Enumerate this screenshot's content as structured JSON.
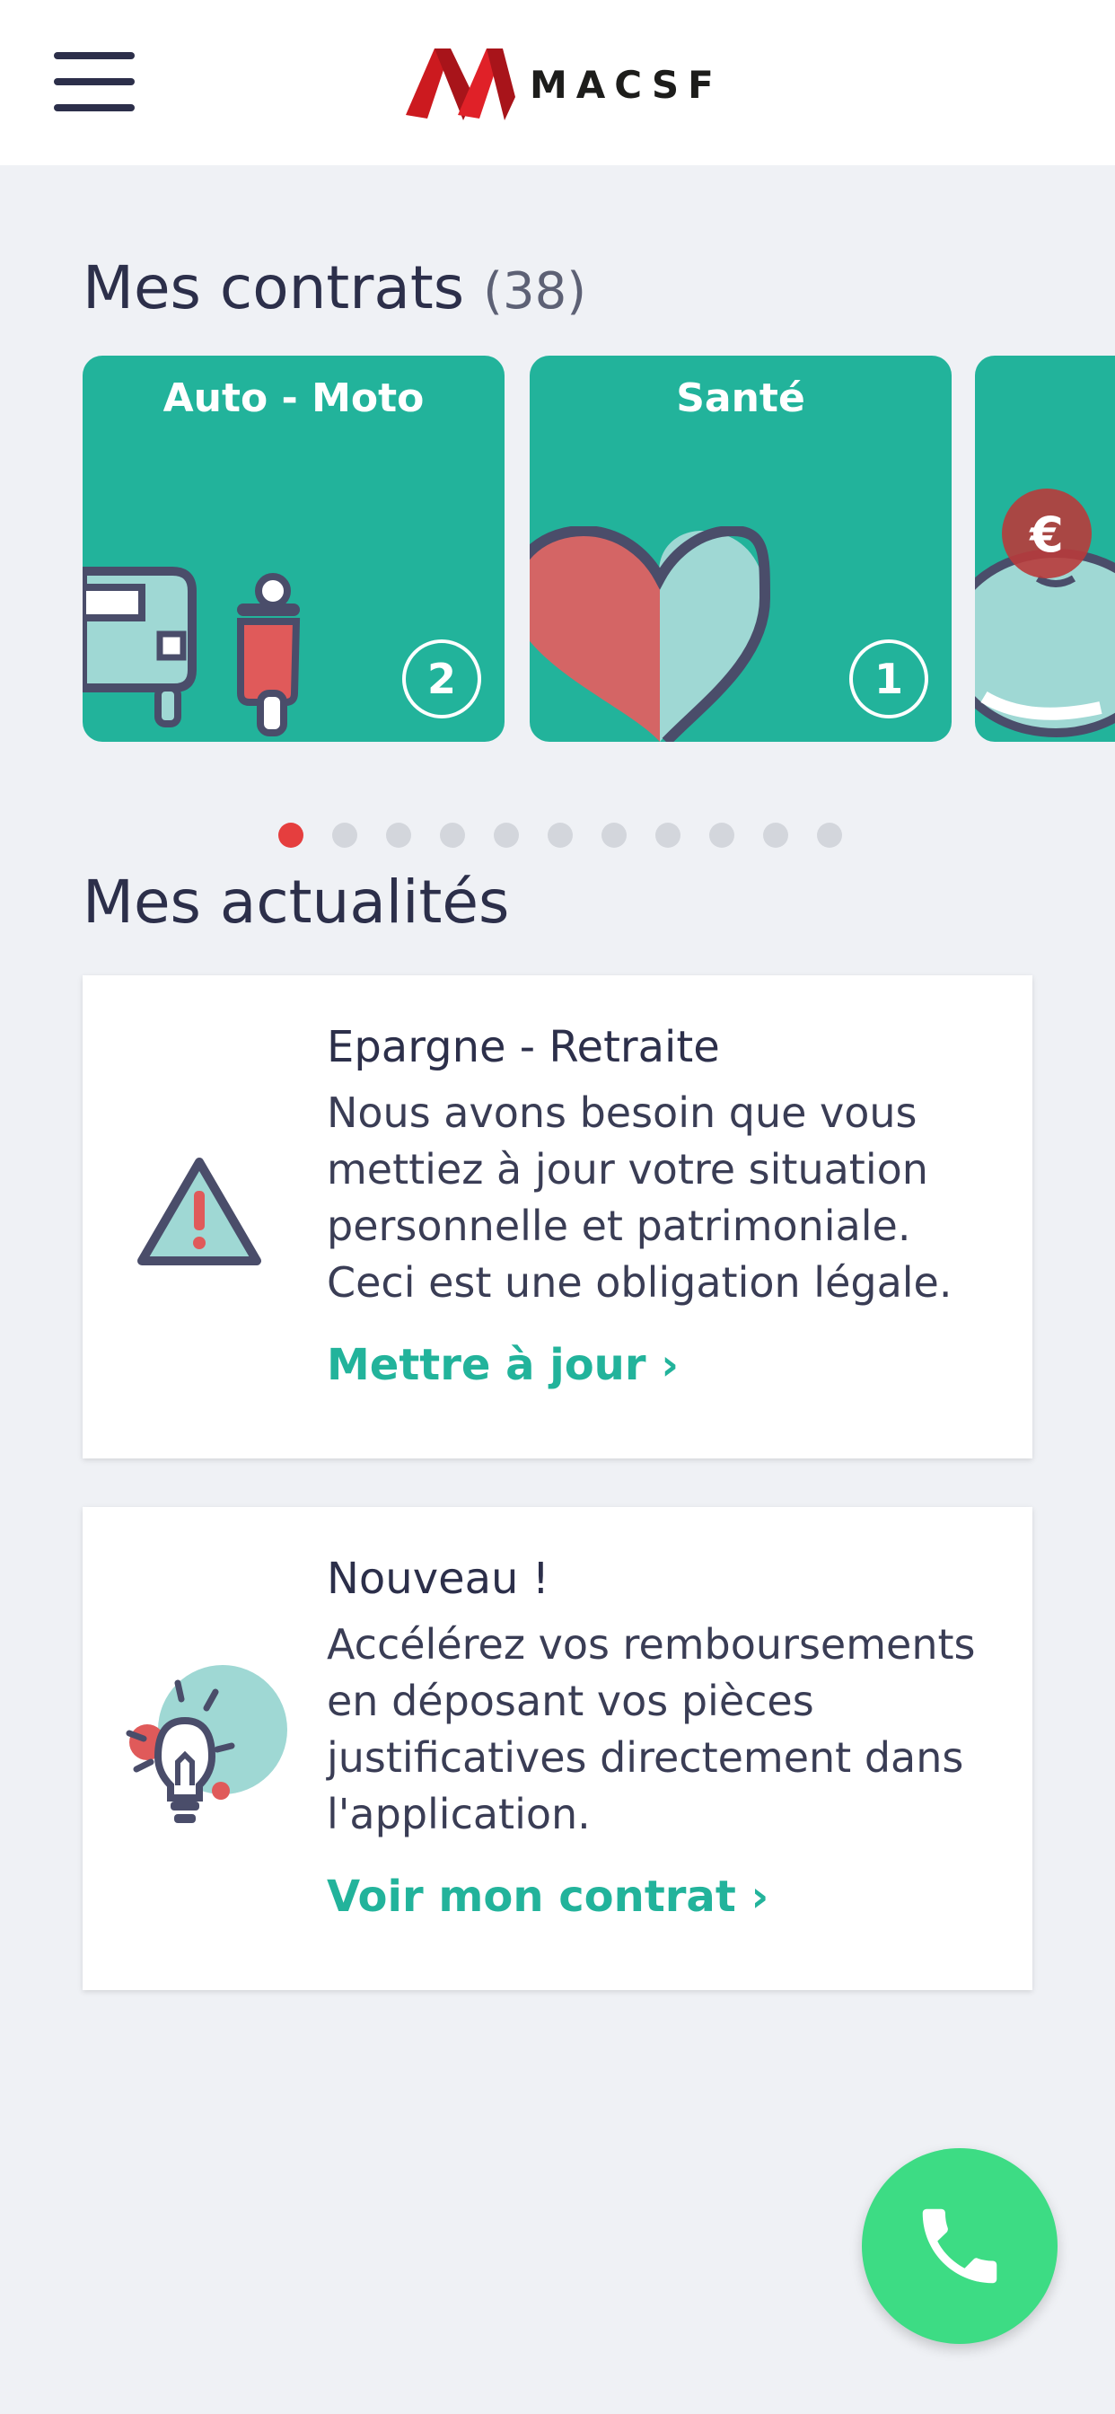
{
  "header": {
    "menu_icon": "hamburger-menu-icon",
    "logo_text": "MACSF",
    "logo_color": "#cc1a1f"
  },
  "contracts": {
    "title": "Mes contrats",
    "count": "(38)",
    "cards": [
      {
        "label": "Auto - Moto",
        "count": "2",
        "icon": "car-scooter-icon"
      },
      {
        "label": "Santé",
        "count": "1",
        "icon": "heart-icon"
      },
      {
        "label": "",
        "count": "",
        "icon": "piggy-bank-euro-icon"
      }
    ],
    "pagination": {
      "total": 11,
      "active": 1
    }
  },
  "news": {
    "title": "Mes actualités",
    "items": [
      {
        "title": "Epargne - Retraite",
        "body": "Nous avons besoin que vous mettiez à jour votre situation personnelle et patrimoniale. Ceci est une obligation légale.",
        "link": "Mettre à jour ›",
        "icon": "warning-triangle-icon"
      },
      {
        "title": "Nouveau !",
        "body": "Accélérez vos remboursements en déposant vos pièces justificatives directement dans l'application.",
        "link": "Voir mon contrat ›",
        "icon": "lightbulb-icon"
      }
    ]
  },
  "fab": {
    "icon": "phone-icon",
    "color": "#3ddc84"
  },
  "colors": {
    "accent": "#22b39b",
    "background": "#eff1f5",
    "text": "#2c2f4a",
    "dot_active": "#e53e3e"
  }
}
